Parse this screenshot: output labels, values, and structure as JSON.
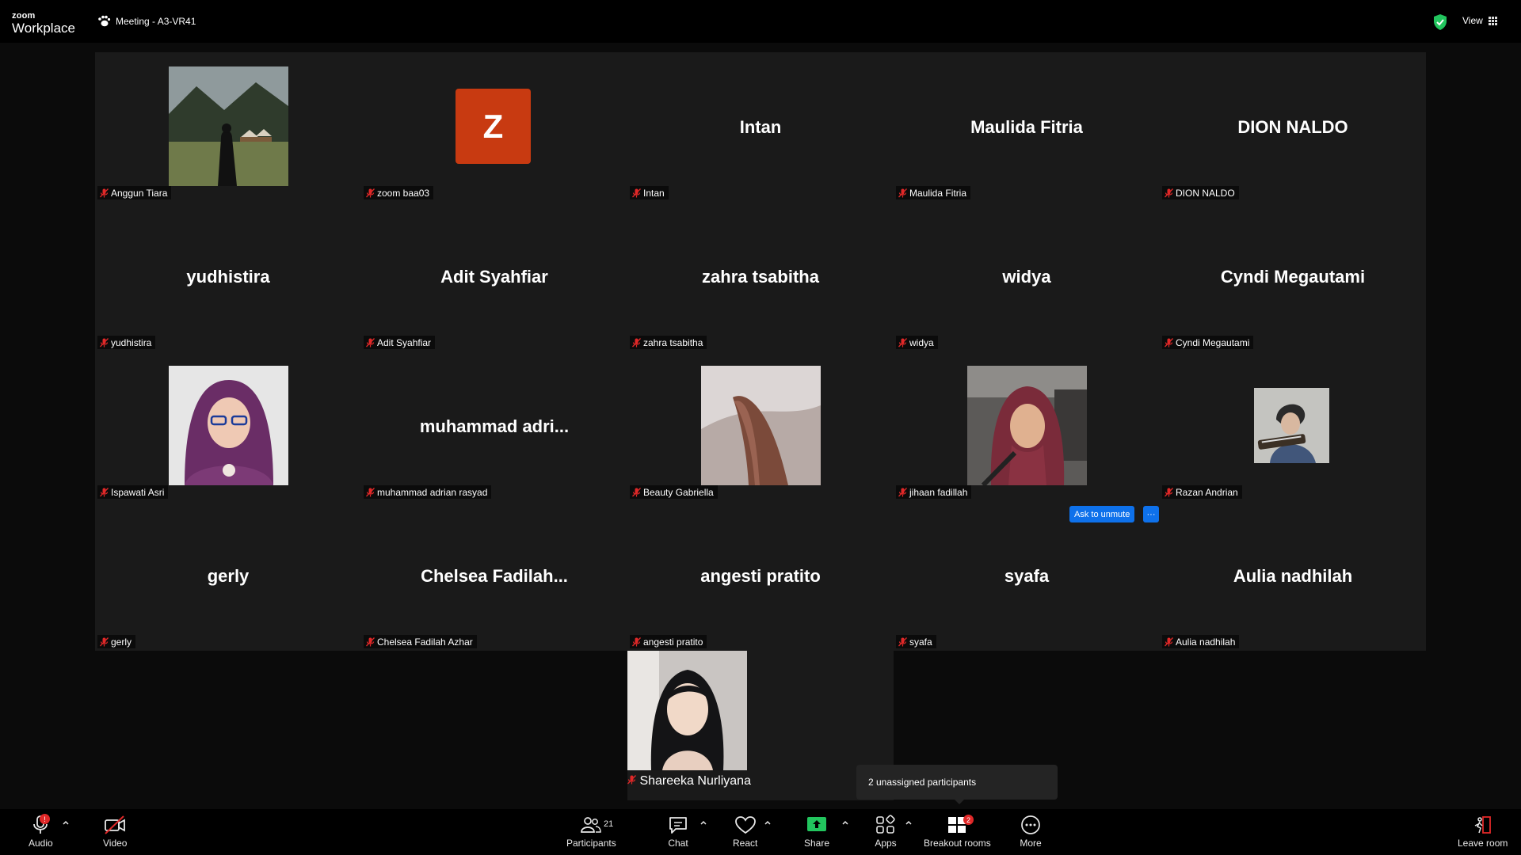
{
  "app": {
    "logo_top": "zoom",
    "logo_bottom": "Workplace",
    "meeting_title": "Meeting - A3-VR41",
    "view_label": "View"
  },
  "tiles": [
    {
      "name": "Anggun Tiara",
      "display": "",
      "kind": "photo",
      "photo": "landscape"
    },
    {
      "name": "zoom baa03",
      "display": "",
      "kind": "avatar",
      "avatar_letter": "Z"
    },
    {
      "name": "Intan",
      "display": "Intan",
      "kind": "text"
    },
    {
      "name": "Maulida Fitria",
      "display": "Maulida Fitria",
      "kind": "text"
    },
    {
      "name": "DION NALDO",
      "display": "DION NALDO",
      "kind": "text"
    },
    {
      "name": "yudhistira",
      "display": "yudhistira",
      "kind": "text"
    },
    {
      "name": "Adit Syahfiar",
      "display": "Adit Syahfiar",
      "kind": "text"
    },
    {
      "name": "zahra tsabitha",
      "display": "zahra tsabitha",
      "kind": "text"
    },
    {
      "name": "widya",
      "display": "widya",
      "kind": "text"
    },
    {
      "name": "Cyndi Megautami",
      "display": "Cyndi Megautami",
      "kind": "text"
    },
    {
      "name": "Ispawati Asri",
      "display": "",
      "kind": "photo",
      "photo": "portrait-purple"
    },
    {
      "name": "muhammad adrian rasyad",
      "display": "muhammad  adri...",
      "kind": "text"
    },
    {
      "name": "Beauty Gabriella",
      "display": "",
      "kind": "photo",
      "photo": "closeup-brown"
    },
    {
      "name": "jihaan fadillah",
      "display": "",
      "kind": "photo",
      "photo": "portrait-car"
    },
    {
      "name": "Razan Andrian",
      "display": "",
      "kind": "photo",
      "photo": "small-guitar"
    },
    {
      "name": "gerly",
      "display": "gerly",
      "kind": "text"
    },
    {
      "name": "Chelsea Fadilah Azhar",
      "display": "Chelsea  Fadilah...",
      "kind": "text"
    },
    {
      "name": "angesti pratito",
      "display": "angesti pratito",
      "kind": "text"
    },
    {
      "name": "syafa",
      "display": "syafa",
      "kind": "text"
    },
    {
      "name": "Aulia nadhilah",
      "display": "Aulia nadhilah",
      "kind": "text"
    }
  ],
  "extra_tile": {
    "name": "Shareeka Nurliyana",
    "kind": "photo",
    "photo": "portrait-dark"
  },
  "hover": {
    "ask_to_unmute": "Ask to unmute",
    "more": "···"
  },
  "tooltip": "2 unassigned participants",
  "toolbar": {
    "audio": "Audio",
    "audio_badge": "!",
    "video": "Video",
    "participants": "Participants",
    "participants_count": "21",
    "chat": "Chat",
    "react": "React",
    "share": "Share",
    "apps": "Apps",
    "breakout": "Breakout rooms",
    "breakout_badge": "2",
    "more": "More",
    "leave": "Leave room"
  },
  "colors": {
    "avatar": "#c83a11",
    "accent_blue": "#0e71eb",
    "share_green": "#22c55e",
    "muted_red": "#e02828",
    "secure_green": "#22c55e"
  }
}
